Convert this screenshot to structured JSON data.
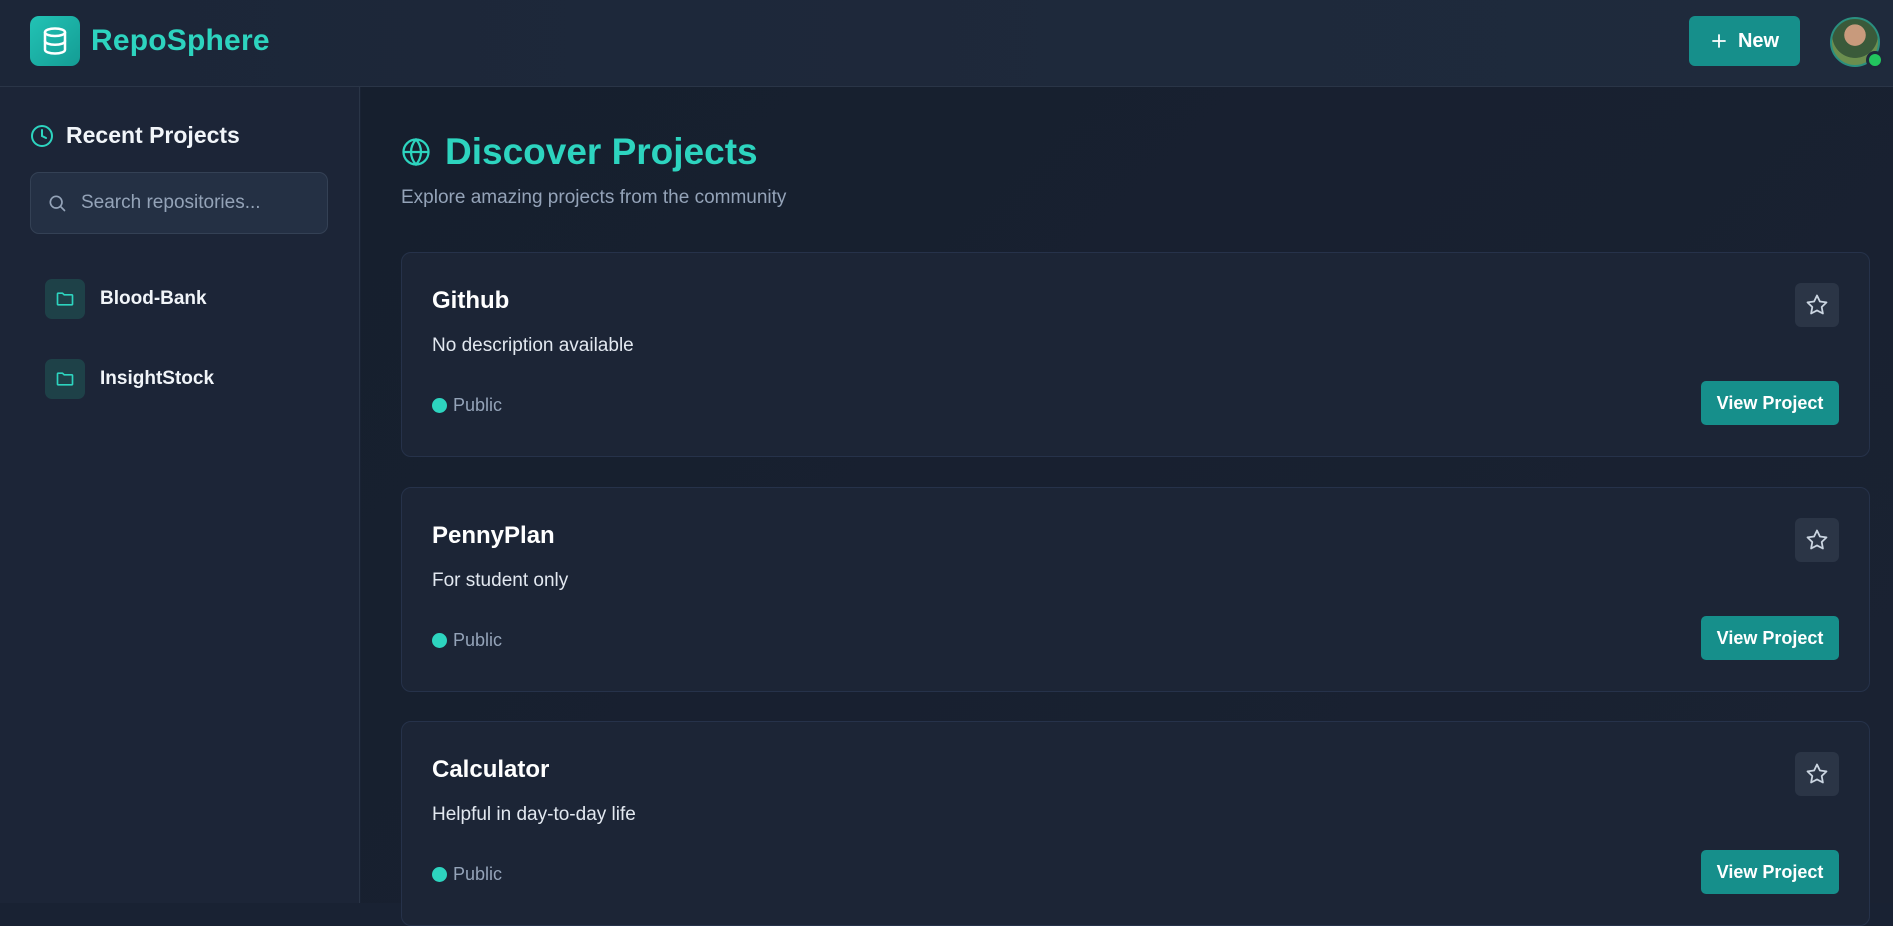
{
  "app": {
    "name": "RepoSphere",
    "new_button_label": "New",
    "accent_color": "#2dd4bf",
    "button_color": "#168f8b"
  },
  "sidebar": {
    "title": "Recent Projects",
    "search_placeholder": "Search repositories...",
    "items": [
      {
        "label": "Blood-Bank",
        "icon": "folder-icon"
      },
      {
        "label": "InsightStock",
        "icon": "folder-icon"
      }
    ]
  },
  "main": {
    "heading": "Discover Projects",
    "subtitle": "Explore amazing projects from the community",
    "projects": [
      {
        "name": "Github",
        "description": "No description available",
        "visibility": "Public",
        "button_label": "View Project"
      },
      {
        "name": "PennyPlan",
        "description": "For student only",
        "visibility": "Public",
        "button_label": "View Project"
      },
      {
        "name": "Calculator",
        "description": "Helpful in day-to-day life",
        "visibility": "Public",
        "button_label": "View Project"
      }
    ]
  }
}
